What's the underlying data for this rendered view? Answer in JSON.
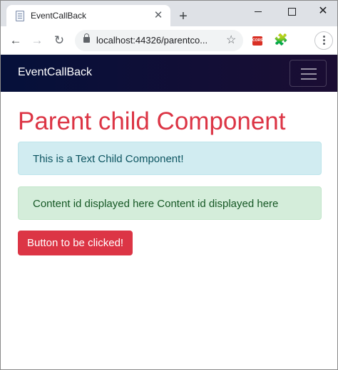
{
  "browser": {
    "tab_title": "EventCallBack",
    "tab_close_glyph": "✕",
    "new_tab_glyph": "+",
    "url": "localhost:44326/parentco...",
    "star_glyph": "☆",
    "back_glyph": "←",
    "forward_glyph": "→",
    "reload_glyph": "↻",
    "close_glyph": "✕",
    "cors_badge": "CORS",
    "puzzle_glyph": "🧩"
  },
  "navbar": {
    "brand": "EventCallBack"
  },
  "main": {
    "title": "Parent child Component",
    "info_alert": "This is a Text Child Component!",
    "success_alert": "Content id displayed here Content id displayed here",
    "button_label": "Button to be clicked!"
  },
  "colors": {
    "title": "#dc3545",
    "button": "#dc3545",
    "navbar_start": "#05103a",
    "navbar_end": "#1b0d33",
    "info_bg": "#d1ecf1",
    "success_bg": "#d4edda"
  },
  "icons": {
    "favicon": "page-icon",
    "lock": "lock-icon",
    "star": "star-icon",
    "extension": "puzzle-icon",
    "menu": "kebab-menu-icon",
    "hamburger": "hamburger-icon"
  }
}
